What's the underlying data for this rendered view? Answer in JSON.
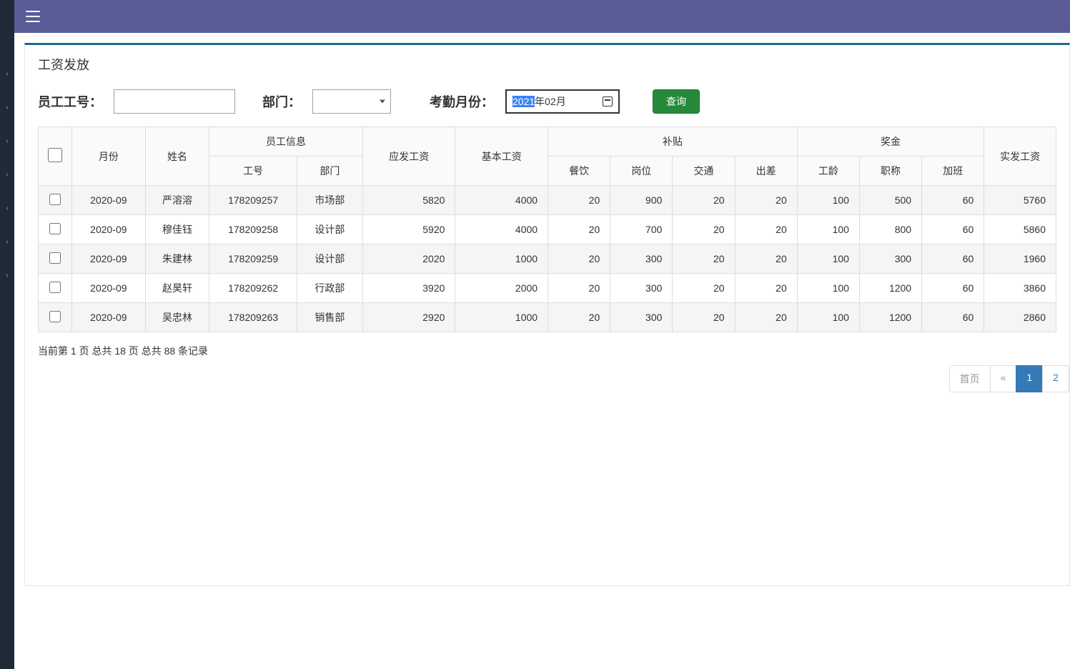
{
  "header": {
    "hamburger_label": "menu"
  },
  "panel": {
    "title": "工资发放"
  },
  "filters": {
    "employee_id_label": "员工工号：",
    "employee_id_value": "",
    "dept_label": "部门：",
    "dept_value": "",
    "month_label": "考勤月份：",
    "month_prefix_selected": "2021",
    "month_rest": "年02月",
    "query_button": "查询"
  },
  "table": {
    "headers": {
      "month": "月份",
      "name": "姓名",
      "emp_group": "员工信息",
      "emp_id": "工号",
      "dept": "部门",
      "gross": "应发工资",
      "base": "基本工资",
      "allowance_group": "补贴",
      "meal": "餐饮",
      "post": "岗位",
      "transport": "交通",
      "travel": "出差",
      "bonus_group": "奖金",
      "seniority": "工龄",
      "title": "职称",
      "overtime": "加班",
      "net": "实发工资"
    },
    "rows": [
      {
        "month": "2020-09",
        "name": "严溶溶",
        "emp_id": "178209257",
        "dept": "市场部",
        "gross": "5820",
        "base": "4000",
        "meal": "20",
        "post": "900",
        "transport": "20",
        "travel": "20",
        "seniority": "100",
        "title": "500",
        "overtime": "60",
        "net": "5760"
      },
      {
        "month": "2020-09",
        "name": "穆佳钰",
        "emp_id": "178209258",
        "dept": "设计部",
        "gross": "5920",
        "base": "4000",
        "meal": "20",
        "post": "700",
        "transport": "20",
        "travel": "20",
        "seniority": "100",
        "title": "800",
        "overtime": "60",
        "net": "5860"
      },
      {
        "month": "2020-09",
        "name": "朱建林",
        "emp_id": "178209259",
        "dept": "设计部",
        "gross": "2020",
        "base": "1000",
        "meal": "20",
        "post": "300",
        "transport": "20",
        "travel": "20",
        "seniority": "100",
        "title": "300",
        "overtime": "60",
        "net": "1960"
      },
      {
        "month": "2020-09",
        "name": "赵昊轩",
        "emp_id": "178209262",
        "dept": "行政部",
        "gross": "3920",
        "base": "2000",
        "meal": "20",
        "post": "300",
        "transport": "20",
        "travel": "20",
        "seniority": "100",
        "title": "1200",
        "overtime": "60",
        "net": "3860"
      },
      {
        "month": "2020-09",
        "name": "吴忠林",
        "emp_id": "178209263",
        "dept": "销售部",
        "gross": "2920",
        "base": "1000",
        "meal": "20",
        "post": "300",
        "transport": "20",
        "travel": "20",
        "seniority": "100",
        "title": "1200",
        "overtime": "60",
        "net": "2860"
      }
    ]
  },
  "footer": {
    "info_text": "当前第 1 页  总共 18 页  总共 88 条记录"
  },
  "pagination": {
    "first": "首页",
    "prev": "«",
    "p1": "1",
    "p2": "2"
  }
}
